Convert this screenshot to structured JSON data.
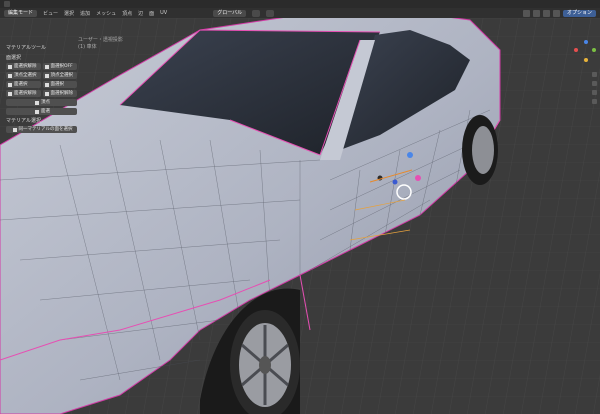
{
  "topbar": {
    "tabs": [
      "",
      "",
      "",
      "",
      "",
      "",
      "",
      "",
      "",
      ""
    ]
  },
  "header": {
    "mode": "編集モード",
    "menus": [
      "ビュー",
      "選択",
      "追加",
      "メッシュ",
      "頂点",
      "辺",
      "面",
      "UV"
    ],
    "transform_orientation": "グローバル",
    "pivot": "",
    "snap": "",
    "options_label": "オプション"
  },
  "overlay_text": {
    "line1": "ユーザー・透視投影",
    "line2": "(1) 車体"
  },
  "panel": {
    "title": "マテリアルツール",
    "section_label": "面選択",
    "buttons_grid": [
      "面選択解除",
      "面選択OFF",
      "頂点全選択",
      "頂点全選択",
      "面選択",
      "面選択",
      "面選択解除",
      "面選択解除"
    ],
    "buttons_wide": [
      "頂点",
      "面選"
    ],
    "material_section_label": "マテリアル選択",
    "material_select_btn": "同一マテリアルの面を選択"
  },
  "colors": {
    "accent": "#3d5f96",
    "seam": "#e64fb3"
  }
}
